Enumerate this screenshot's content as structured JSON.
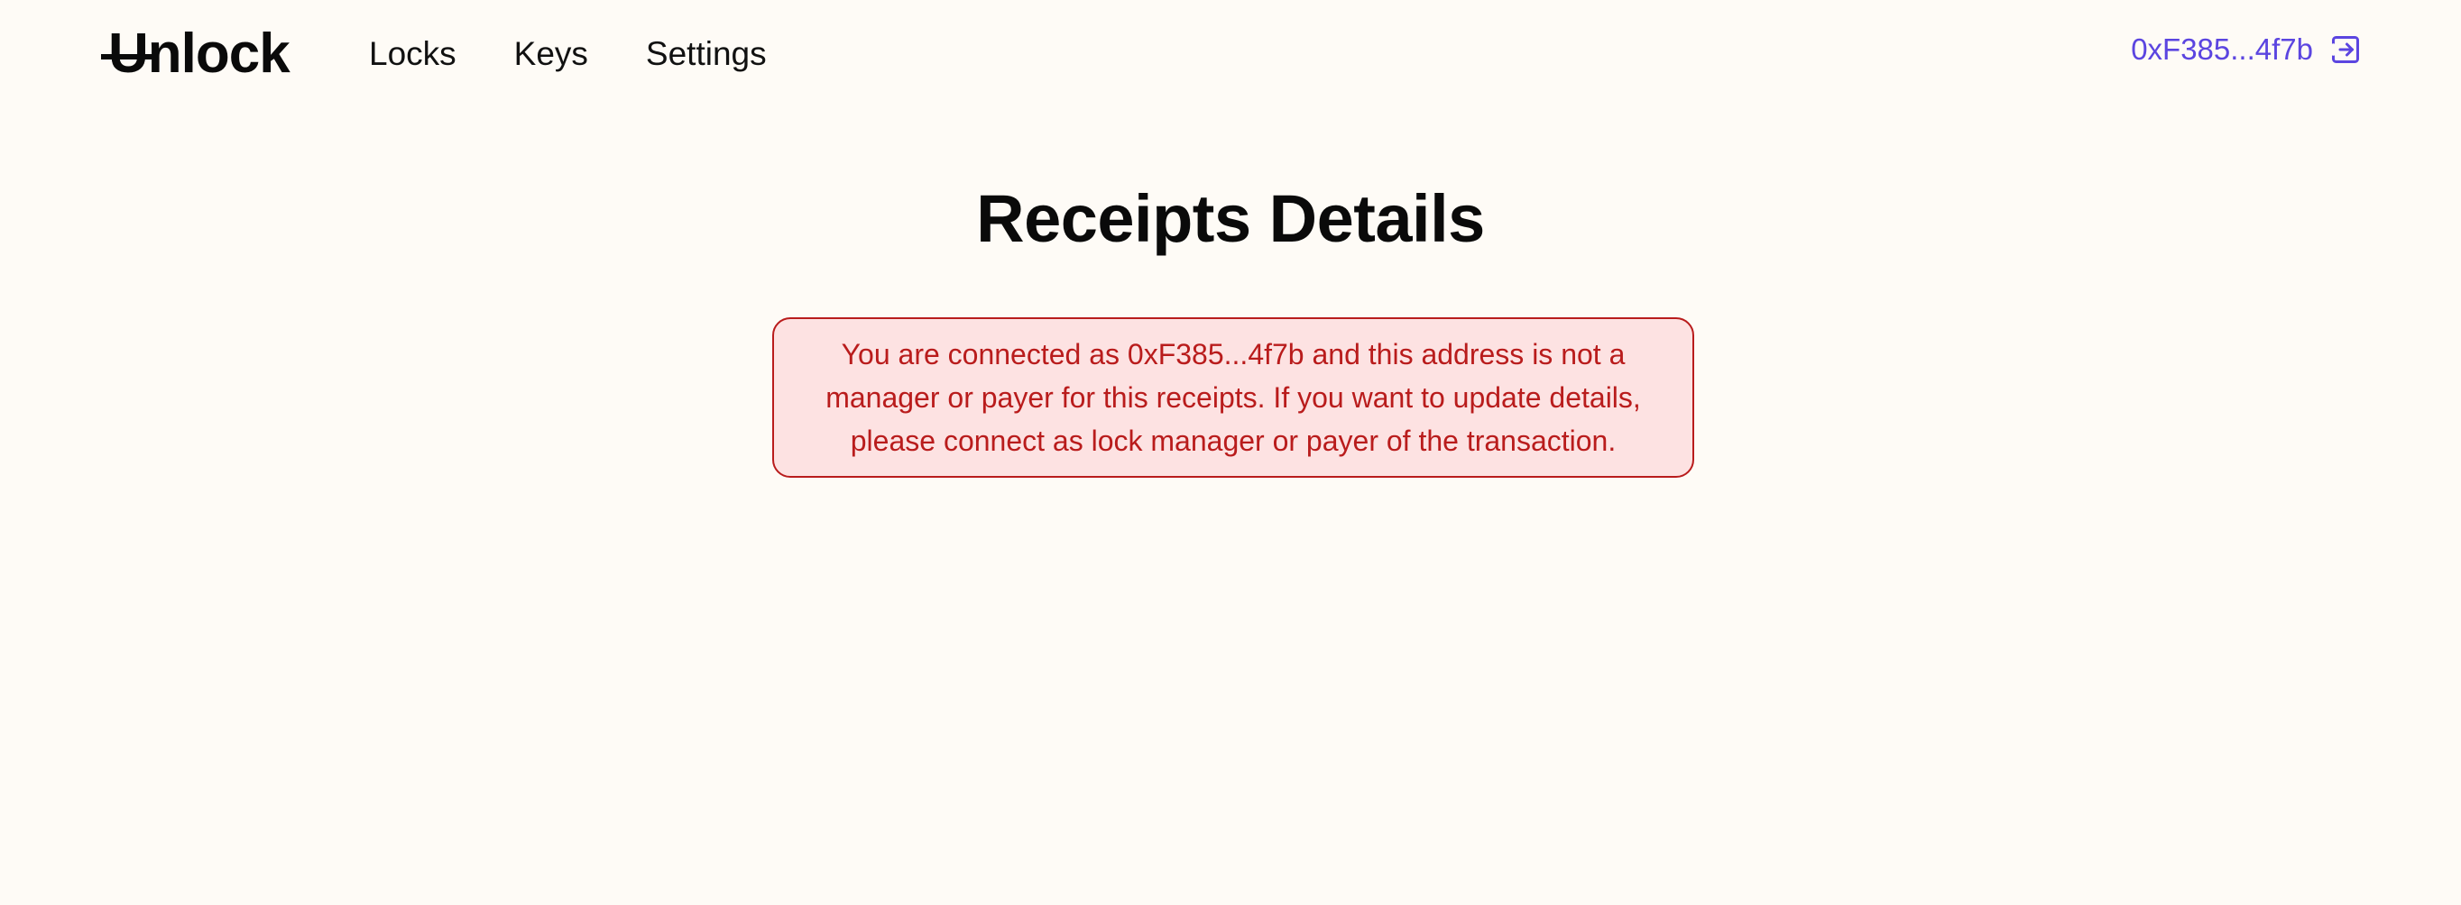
{
  "header": {
    "logo": "Unlock",
    "nav": {
      "locks": "Locks",
      "keys": "Keys",
      "settings": "Settings"
    },
    "wallet": {
      "address": "0xF385...4f7b",
      "icon": "logout-icon"
    }
  },
  "main": {
    "title": "Receipts Details",
    "alert": {
      "message": "You are connected as 0xF385...4f7b and this address is not a manager or payer for this receipts. If you want to update details, please connect as lock manager or payer of the transaction."
    }
  },
  "colors": {
    "background": "#fefbf6",
    "accent": "#5b45e0",
    "alert_text": "#b91c1c",
    "alert_bg": "#fde2e2"
  }
}
